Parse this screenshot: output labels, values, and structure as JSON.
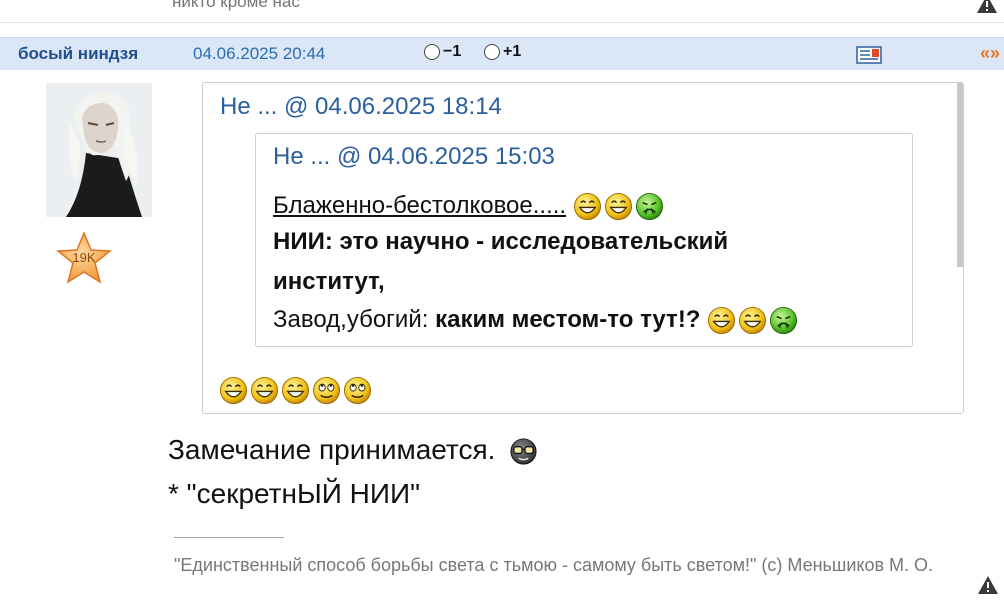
{
  "prev_post": {
    "text": "никто кроме нас"
  },
  "post": {
    "author": "босый ниндзя",
    "date": "04.06.2025 20:44",
    "vote_minus": "−1",
    "vote_plus": "+1",
    "quote_link": "«»",
    "avatar_badge": "19K",
    "quote_outer": {
      "header": "Не ... @ 04.06.2025 18:14"
    },
    "quote_inner": {
      "header": "Не ... @ 04.06.2025 15:03",
      "line1": "Блаженно-бестолковое.....",
      "line2": "НИИ: это научно - исследовательский",
      "line3": "институт,",
      "line4_plain": "Завод,убогий: ",
      "line4_bold": "каким местом-то тут!?"
    },
    "reply_line1": "Замечание принимается.",
    "reply_line2": "* \"секретнЫЙ НИИ\"",
    "signature": "\"Единственный способ борьбы света с тьмою - самому быть светом!\" (c) Меньшиков М. О."
  },
  "colors": {
    "header_bg": "#dbe7f7",
    "author": "#1f4f8f",
    "date": "#2a6db5",
    "quote_link": "#e07a1c"
  }
}
